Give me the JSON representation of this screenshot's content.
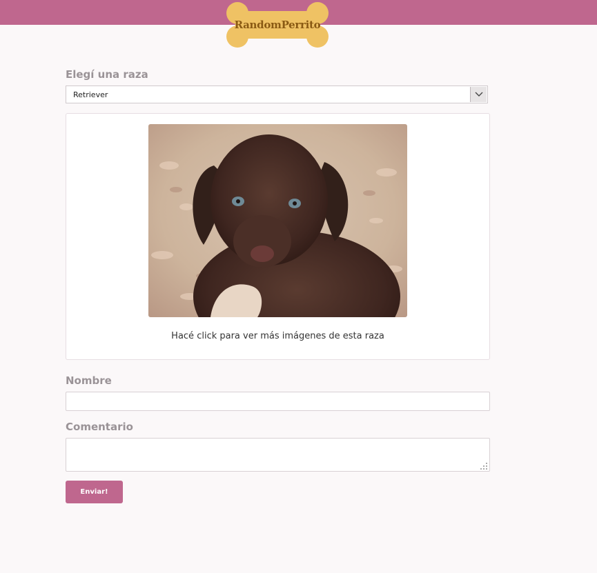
{
  "brand": {
    "logo_text": "RandomPerrito",
    "bar_color": "#bf678e",
    "bone_color": "#efc264"
  },
  "breed_select": {
    "label": "Elegí una raza",
    "selected": "Retriever",
    "chevron_icon": "chevron-down-icon"
  },
  "gallery": {
    "image_alt": "puppy photo (chocolate retriever)",
    "caption": "Hacé click para ver más imágenes de esta raza"
  },
  "form": {
    "name_label": "Nombre",
    "name_value": "",
    "comment_label": "Comentario",
    "comment_value": "",
    "submit_label": "Enviar!"
  }
}
